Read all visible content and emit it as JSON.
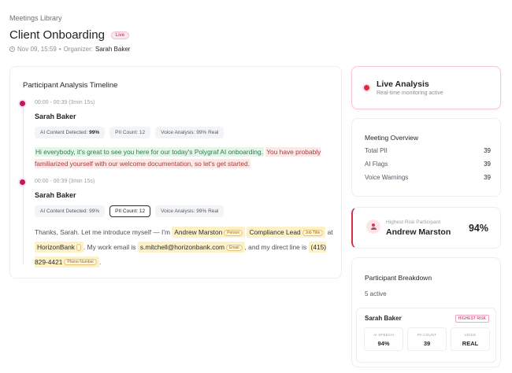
{
  "header": {
    "breadcrumb": "Meetings Library",
    "title": "Client Onboarding",
    "live_badge": "Live",
    "datetime": "Nov 09, 15:59",
    "separator": "•",
    "organizer_label": "Organizer:",
    "organizer_name": "Sarah Baker"
  },
  "timeline": {
    "title": "Participant Analysis Timeline",
    "entries": [
      {
        "time": "00:00 - 00:39 (3min 15s)",
        "speaker": "Sarah Baker",
        "chips": {
          "ai_label": "AI Content Detected:",
          "ai_value": "99%",
          "pii": "PII Count: 12",
          "voice": "Voice Analysis: 99% Real"
        },
        "green_text": "Hi everybody, it's great to see you here for our today's Polygraf AI onboarding.",
        "red_text": "You have probably familiarized yourself with our welcome documentation, so let's get started."
      },
      {
        "time": "00:00 - 00:39 (3min 15s)",
        "speaker": "Sarah Baker",
        "chips": {
          "ai": "AI Content Detected: 99%",
          "pii": "PII Count: 12",
          "voice": "Voice Analysis: 99% Real"
        },
        "t1": "Thanks, Sarah. Let me introduce myself — I'm",
        "e1": "Andrew Marston",
        "e1_tag": "Person",
        "e2": "Compliance Lead",
        "e2_tag": "Job Title",
        "t2": "at",
        "e3": "HorizonBank",
        "t3": ". My work email is",
        "e4": "s.mitchell@horizonbank.com",
        "e4_tag": "Email",
        "t4": ", and my direct line is",
        "e5": "(415) 829-4421",
        "e5_tag": "Phone Number",
        "t5": "."
      }
    ]
  },
  "live_analysis": {
    "title": "Live Analysis",
    "subtitle": "Real-time monitoring active"
  },
  "overview": {
    "title": "Meeting Overview",
    "rows": [
      {
        "label": "Total PII",
        "value": "39"
      },
      {
        "label": "AI Flags",
        "value": "39"
      },
      {
        "label": "Voice Warnings",
        "value": "39"
      }
    ]
  },
  "highest_risk": {
    "label": "Highest Risk Participant",
    "name": "Andrew Marston",
    "percent": "94%"
  },
  "breakdown": {
    "title": "Participant Breakdown",
    "active": "5 active",
    "person": {
      "name": "Sarah Baker",
      "badge": "HIGHEST RISK",
      "stats": [
        {
          "label": "AI SPEECH",
          "value": "94%"
        },
        {
          "label": "PII COUNT",
          "value": "39"
        },
        {
          "label": "VOICE",
          "value": "REAL"
        }
      ]
    }
  },
  "colors": {
    "accent": "#c2185b",
    "danger": "#d32f46",
    "ai_highlight": "#e3f6e9",
    "risk_highlight": "#fde7e7",
    "pii_highlight": "#fdf1c7"
  }
}
